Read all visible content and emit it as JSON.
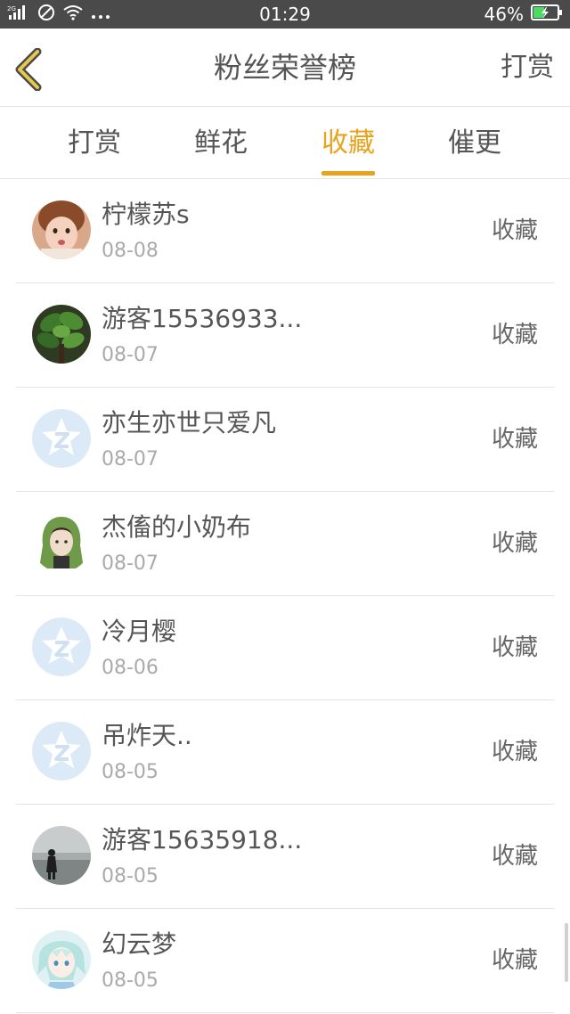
{
  "status_bar": {
    "network": "2G",
    "time": "01:29",
    "battery": "46%",
    "battery_level": 0.46,
    "icons": [
      "signal-icon",
      "no-disturb-icon",
      "wifi-icon",
      "more-icon",
      "battery-icon"
    ]
  },
  "header": {
    "back_icon": "chevron-left-icon",
    "title": "粉丝荣誉榜",
    "action_label": "打赏"
  },
  "tabs": [
    {
      "label": "打赏"
    },
    {
      "label": "鲜花"
    },
    {
      "label": "收藏",
      "active": true
    },
    {
      "label": "催更"
    }
  ],
  "colors": {
    "accent": "#e8a21c",
    "text": "#555555",
    "muted": "#aaaaaa",
    "status_bar": "#4a4a4a",
    "battery": "#4cd964"
  },
  "fans": [
    {
      "name": "柠檬苏s",
      "date": "08-08",
      "action": "收藏",
      "avatar": "photo-girl-avatar"
    },
    {
      "name": "游客15536933...",
      "date": "08-07",
      "action": "收藏",
      "avatar": "plant-avatar"
    },
    {
      "name": "亦生亦世只爱凡",
      "date": "08-07",
      "action": "收藏",
      "avatar": "default-star-avatar"
    },
    {
      "name": "杰傗的小奶布",
      "date": "08-07",
      "action": "收藏",
      "avatar": "green-hood-avatar"
    },
    {
      "name": "冷月樱",
      "date": "08-06",
      "action": "收藏",
      "avatar": "default-star-avatar"
    },
    {
      "name": "吊炸天..",
      "date": "08-05",
      "action": "收藏",
      "avatar": "default-star-avatar"
    },
    {
      "name": "游客15635918...",
      "date": "08-05",
      "action": "收藏",
      "avatar": "photo-figure-avatar"
    },
    {
      "name": "幻云梦",
      "date": "08-05",
      "action": "收藏",
      "avatar": "anime-avatar"
    }
  ]
}
